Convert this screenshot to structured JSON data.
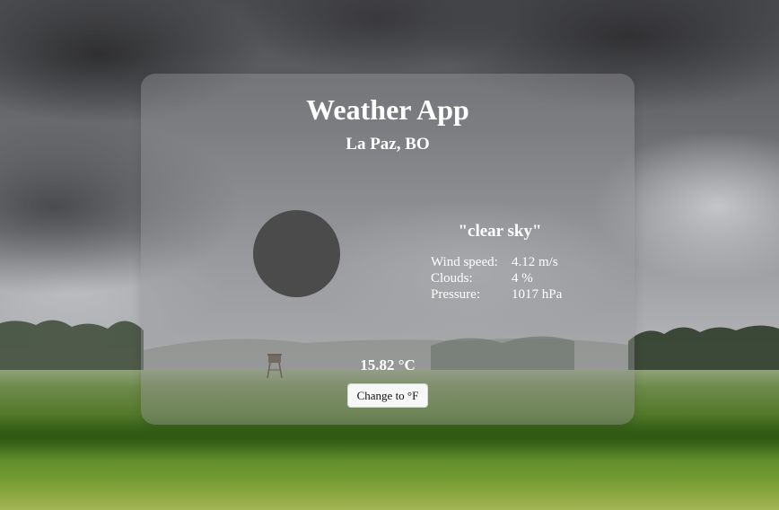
{
  "app": {
    "title": "Weather App"
  },
  "location": {
    "display": "La Paz, BO"
  },
  "weather": {
    "description": "\"clear sky\"",
    "icon": "weather-condition-icon",
    "details": [
      {
        "label": "Wind speed:",
        "value": "4.12 m/s"
      },
      {
        "label": "Clouds:",
        "value": "4 %"
      },
      {
        "label": "Pressure:",
        "value": "1017 hPa"
      }
    ]
  },
  "temperature": {
    "display": "15.82 °C"
  },
  "controls": {
    "unit_toggle_label": "Change to °F"
  },
  "colors": {
    "card_background": "#969698",
    "icon_placeholder": "#4b4b4c",
    "text": "#ffffff",
    "button_background": "#f7f7f7"
  }
}
